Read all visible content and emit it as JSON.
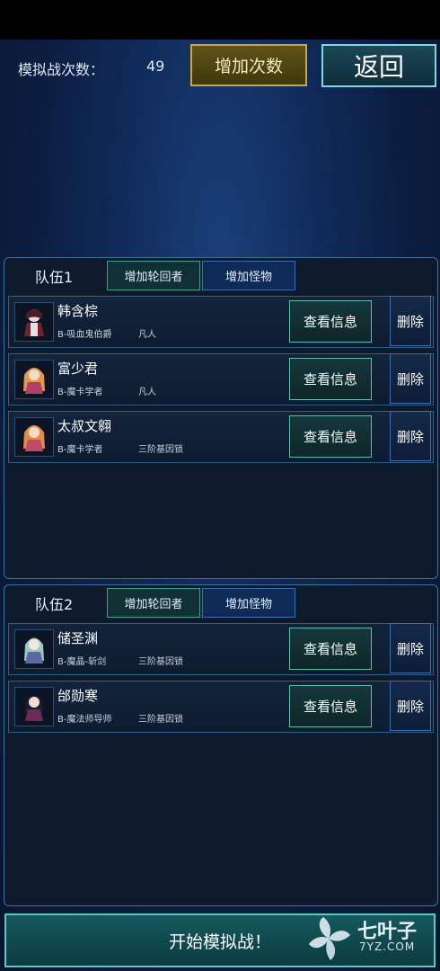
{
  "header": {
    "count_label": "模拟战次数：",
    "count_value": "49",
    "add_count_label": "增加次数",
    "back_label": "返回"
  },
  "teams": [
    {
      "title": "队伍1",
      "tab_reincarnator": "增加轮回者",
      "tab_monster": "增加怪物",
      "members": [
        {
          "name": "韩含棕",
          "race": "B-吸血鬼伯爵",
          "rank": "凡人",
          "view": "查看信息",
          "delete": "删除"
        },
        {
          "name": "富少君",
          "race": "B-魔卡学者",
          "rank": "凡人",
          "view": "查看信息",
          "delete": "删除"
        },
        {
          "name": "太叔文翱",
          "race": "B-魔卡学者",
          "rank": "三阶基因锁",
          "view": "查看信息",
          "delete": "删除"
        }
      ]
    },
    {
      "title": "队伍2",
      "tab_reincarnator": "增加轮回者",
      "tab_monster": "增加怪物",
      "members": [
        {
          "name": "储圣渊",
          "race": "B-魔晶-斩剑",
          "rank": "三阶基因锁",
          "view": "查看信息",
          "delete": "删除"
        },
        {
          "name": "邰勋寒",
          "race": "B-魔法师导师",
          "rank": "三阶基因锁",
          "view": "查看信息",
          "delete": "删除"
        }
      ]
    }
  ],
  "footer": {
    "start_label": "开始模拟战！",
    "watermark_text": "七叶子",
    "watermark_sub": "7YZ.COM"
  },
  "colors": {
    "accent_gold": "#c9a93a",
    "accent_teal": "#5fc6c0",
    "accent_blue": "#3a6eb0",
    "panel_bg": "#0d1a2c"
  }
}
